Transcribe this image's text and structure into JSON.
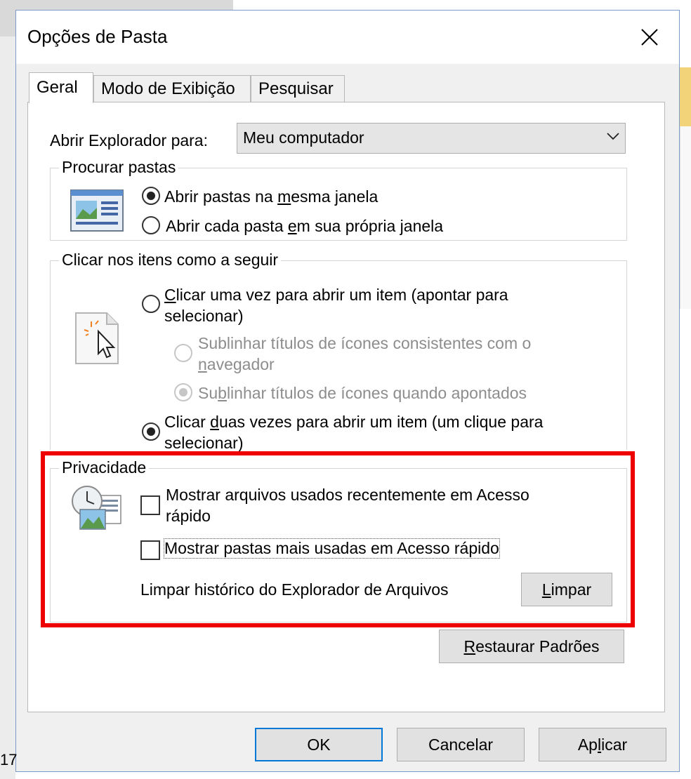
{
  "dialog": {
    "title": "Opções de Pasta"
  },
  "tabs": [
    {
      "label": "Geral",
      "active": true
    },
    {
      "label": "Modo de Exibição",
      "active": false
    },
    {
      "label": "Pesquisar",
      "active": false
    }
  ],
  "general": {
    "open_explorer_label": "Abrir Explorador para:",
    "open_explorer_value": "Meu computador"
  },
  "browse_folders": {
    "legend": "Procurar pastas",
    "icon": "folder-window-icon",
    "option_same_window": {
      "pre": "Abrir pastas na ",
      "u": "m",
      "post": "esma janela",
      "checked": true
    },
    "option_own_window": {
      "pre": "Abrir cada pasta ",
      "u": "e",
      "post": "m sua própria janela",
      "checked": false
    }
  },
  "click_items": {
    "legend": "Clicar nos itens como a seguir",
    "icon": "pointer-click-icon",
    "single_click": {
      "u": "C",
      "text": "licar uma vez para abrir um item (apontar para",
      "line2": "selecionar)",
      "checked": false
    },
    "underline_consistent": {
      "text": "Sublinhar títulos de ícones consistentes com o",
      "line2_pre": "",
      "line2_u": "n",
      "line2_post": "avegador",
      "checked": false,
      "disabled": true
    },
    "underline_hover": {
      "pre": "Su",
      "u": "b",
      "post": "linhar títulos de ícones quando apontados",
      "checked": true,
      "disabled": true
    },
    "double_click": {
      "pre": "Clicar ",
      "u": "d",
      "post": "uas vezes para abrir um item (um clique para",
      "line2": "selecionar)",
      "checked": true
    }
  },
  "privacy": {
    "legend": "Privacidade",
    "icon": "clock-documents-icon",
    "show_recent_files": {
      "text": "Mostrar arquivos usados recentemente em Acesso",
      "line2": "rápido",
      "checked": false
    },
    "show_frequent_folders": {
      "text": "Mostrar pastas mais usadas em Acesso rápido",
      "checked": false
    },
    "clear_history_label": "Limpar histórico do Explorador de Arquivos",
    "clear_button": {
      "u": "L",
      "post": "impar"
    }
  },
  "restore_button": {
    "u": "R",
    "post": "estaurar Padrões"
  },
  "footer": {
    "ok": "OK",
    "cancel": "Cancelar",
    "apply_pre": "Ap",
    "apply_u": "l",
    "apply_post": "icar"
  },
  "background": {
    "left_edge_text": "17"
  },
  "colors": {
    "highlight_border": "#ee0000",
    "default_button_border": "#0078d7",
    "disabled_text": "#8d8d8d"
  }
}
